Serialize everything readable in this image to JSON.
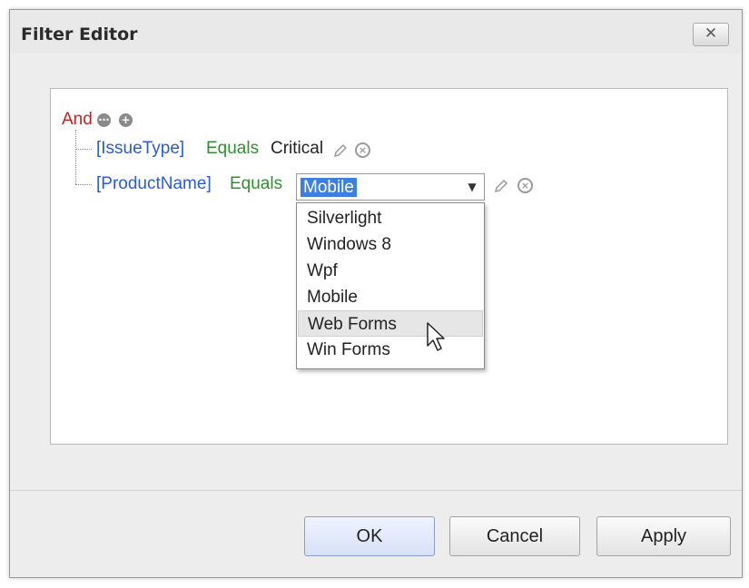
{
  "window": {
    "title": "Filter Editor",
    "close_glyph": "✕"
  },
  "tree": {
    "root_operator": "And",
    "root_icons": [
      "ellipsis-circle-icon",
      "plus-circle-icon"
    ],
    "conditions": [
      {
        "field": "[IssueType]",
        "operator": "Equals",
        "value": "Critical"
      },
      {
        "field": "[ProductName]",
        "operator": "Equals",
        "value": "Mobile"
      }
    ]
  },
  "combo": {
    "selected": "Mobile",
    "arrow_glyph": "▼"
  },
  "dropdown": {
    "items": [
      "Silverlight",
      "Windows 8",
      "Wpf",
      "Mobile",
      "Web Forms",
      "Win Forms"
    ],
    "hovered": "Web Forms"
  },
  "buttons": {
    "ok": "OK",
    "cancel": "Cancel",
    "apply": "Apply"
  },
  "colors": {
    "operator": "#c81e1e",
    "field": "#2a5bd7",
    "comparison": "#2f8f2f",
    "selection": "#3d7fe0"
  }
}
